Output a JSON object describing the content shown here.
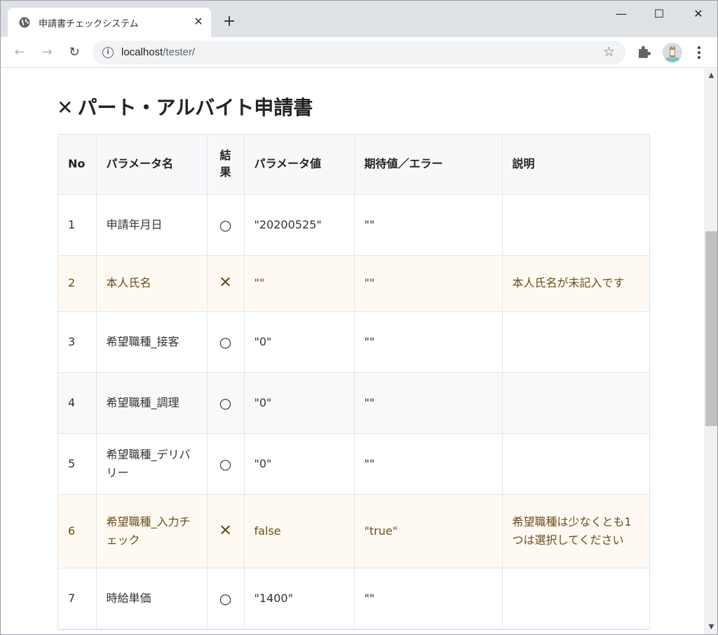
{
  "browser": {
    "tab_title": "申請書チェックシステム",
    "tab_close": "✕",
    "new_tab": "+",
    "url_host": "localhost",
    "url_path": "/tester/",
    "window": {
      "minimize": "—",
      "maximize": "☐",
      "close": "✕"
    },
    "nav": {
      "back": "←",
      "forward": "→",
      "reload": "↻"
    },
    "star": "☆",
    "info": "i"
  },
  "page": {
    "title_mark": "✕",
    "title": "パート・アルバイト申請書"
  },
  "table": {
    "headers": {
      "no": "No",
      "param_name": "パラメータ名",
      "result_1": "結",
      "result_2": "果",
      "param_value": "パラメータ値",
      "expected": "期待値／エラー",
      "description": "説明"
    },
    "rows": [
      {
        "no": "1",
        "name": "申請年月日",
        "result": "○",
        "value": "\"20200525\"",
        "expected": "\"\"",
        "description": ""
      },
      {
        "no": "2",
        "name": "本人氏名",
        "result": "✕",
        "value": "\"\"",
        "expected": "\"\"",
        "description": "本人氏名が未記入です"
      },
      {
        "no": "3",
        "name": "希望職種_接客",
        "result": "○",
        "value": "\"0\"",
        "expected": "\"\"",
        "description": ""
      },
      {
        "no": "4",
        "name": "希望職種_調理",
        "result": "○",
        "value": "\"0\"",
        "expected": "\"\"",
        "description": ""
      },
      {
        "no": "5",
        "name": "希望職種_デリバリー",
        "result": "○",
        "value": "\"0\"",
        "expected": "\"\"",
        "description": ""
      },
      {
        "no": "6",
        "name": "希望職種_入力チェック",
        "result": "✕",
        "value": "false",
        "expected": "\"true\"",
        "description": "希望職種は少なくとも1つは選択してください"
      },
      {
        "no": "7",
        "name": "時給単価",
        "result": "○",
        "value": "\"1400\"",
        "expected": "\"\"",
        "description": ""
      }
    ]
  },
  "colors": {
    "error_row_bg": "#fefaf3",
    "error_text": "#6a4d1a",
    "alt_row_bg": "#f8f9fa"
  }
}
